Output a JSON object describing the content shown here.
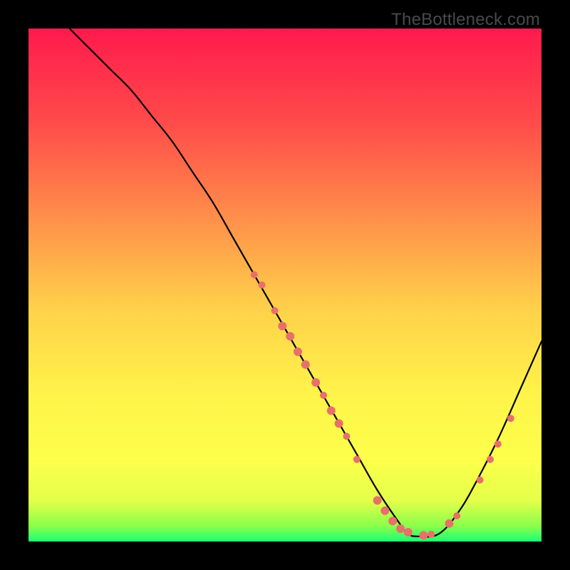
{
  "watermark": "TheBottleneck.com",
  "colors": {
    "background": "#000000",
    "curve": "#000000",
    "marker": "#e77168",
    "watermark": "#4a4a4a",
    "gradient_stops": [
      {
        "offset": 0.0,
        "color": "#ff1a4d"
      },
      {
        "offset": 0.18,
        "color": "#ff4a4a"
      },
      {
        "offset": 0.38,
        "color": "#ff934a"
      },
      {
        "offset": 0.55,
        "color": "#ffd24a"
      },
      {
        "offset": 0.72,
        "color": "#fff44a"
      },
      {
        "offset": 0.84,
        "color": "#fdff4a"
      },
      {
        "offset": 0.92,
        "color": "#e4ff4a"
      },
      {
        "offset": 0.97,
        "color": "#8aff4a"
      },
      {
        "offset": 1.0,
        "color": "#1aff76"
      }
    ]
  },
  "chart_data": {
    "type": "line",
    "title": "",
    "xlabel": "",
    "ylabel": "",
    "xlim": [
      0,
      100
    ],
    "ylim": [
      0,
      100
    ],
    "note": "y = 0 is the bottom edge of the gradient. The curve is a bottleneck profile descending from top-left to a trough near x≈73 then rising to the right edge.",
    "series": [
      {
        "name": "bottleneck-curve",
        "x": [
          8,
          12,
          16,
          20,
          24,
          28,
          32,
          36,
          40,
          44,
          48,
          52,
          56,
          60,
          64,
          68,
          72,
          74,
          76,
          80,
          84,
          88,
          92,
          96,
          100
        ],
        "y": [
          100,
          96,
          92,
          88,
          83,
          78,
          72,
          66,
          59,
          52,
          45,
          38,
          31,
          24,
          17,
          10,
          4,
          1.5,
          1,
          1.5,
          6,
          13,
          21,
          30,
          39
        ]
      }
    ],
    "markers": [
      {
        "x": 44,
        "y": 52,
        "r": 5
      },
      {
        "x": 45.5,
        "y": 50,
        "r": 5
      },
      {
        "x": 48,
        "y": 45,
        "r": 5
      },
      {
        "x": 49.5,
        "y": 42,
        "r": 6
      },
      {
        "x": 51,
        "y": 40,
        "r": 6
      },
      {
        "x": 52.5,
        "y": 37,
        "r": 6
      },
      {
        "x": 54,
        "y": 34.5,
        "r": 6
      },
      {
        "x": 56,
        "y": 31,
        "r": 6
      },
      {
        "x": 57.5,
        "y": 28.5,
        "r": 5
      },
      {
        "x": 59,
        "y": 25.5,
        "r": 6
      },
      {
        "x": 60.5,
        "y": 23,
        "r": 6
      },
      {
        "x": 62,
        "y": 20.5,
        "r": 5
      },
      {
        "x": 64,
        "y": 16,
        "r": 5
      },
      {
        "x": 68,
        "y": 8,
        "r": 6
      },
      {
        "x": 69.5,
        "y": 6,
        "r": 6
      },
      {
        "x": 71,
        "y": 4,
        "r": 6
      },
      {
        "x": 72.5,
        "y": 2.5,
        "r": 6
      },
      {
        "x": 74,
        "y": 1.8,
        "r": 6
      },
      {
        "x": 77,
        "y": 1.2,
        "r": 6
      },
      {
        "x": 78.5,
        "y": 1.4,
        "r": 5
      },
      {
        "x": 82,
        "y": 3.5,
        "r": 6
      },
      {
        "x": 83.5,
        "y": 5,
        "r": 5
      },
      {
        "x": 88,
        "y": 12,
        "r": 5
      },
      {
        "x": 90,
        "y": 16,
        "r": 5
      },
      {
        "x": 91.5,
        "y": 19,
        "r": 5
      },
      {
        "x": 94,
        "y": 24,
        "r": 5
      }
    ]
  }
}
